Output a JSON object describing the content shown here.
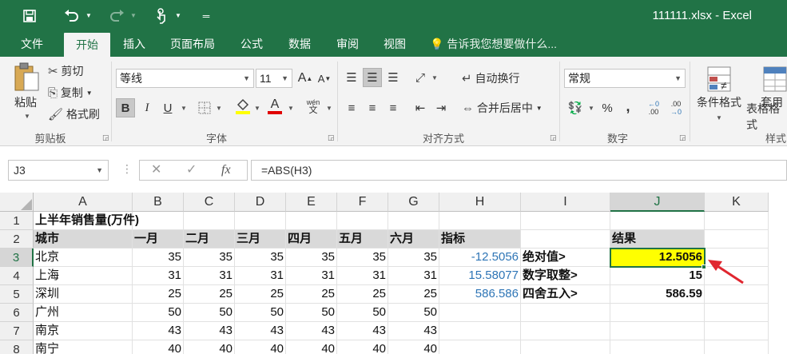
{
  "app": {
    "doc_title": "111111.xlsx - Excel",
    "accent": "#217346"
  },
  "quick_access": {
    "save_icon": "save-icon",
    "undo_icon": "undo-icon",
    "redo_icon": "redo-icon",
    "touch_icon": "touch-mode-icon",
    "customize_icon": "customize-icon"
  },
  "tabs": [
    {
      "label": "文件"
    },
    {
      "label": "开始"
    },
    {
      "label": "插入"
    },
    {
      "label": "页面布局"
    },
    {
      "label": "公式"
    },
    {
      "label": "数据"
    },
    {
      "label": "审阅"
    },
    {
      "label": "视图"
    }
  ],
  "tellme": "告诉我您想要做什么...",
  "ribbon": {
    "clipboard": {
      "paste": "粘贴",
      "cut": "剪切",
      "copy": "复制",
      "format_painter": "格式刷",
      "label": "剪贴板"
    },
    "font": {
      "font_name": "等线",
      "font_size": "11",
      "bold": "B",
      "italic": "I",
      "underline": "U",
      "font_color_glyph": "A",
      "grow": "A",
      "shrink": "A",
      "phonetic": "wén",
      "label": "字体"
    },
    "alignment": {
      "wrap": "自动换行",
      "merge": "合并后居中",
      "label": "对齐方式"
    },
    "number": {
      "format": "常规",
      "percent": "%",
      "comma": ",",
      "inc_decimal": ".00",
      "dec_decimal": ".00",
      "label": "数字"
    },
    "styles": {
      "conditional": "条件格式",
      "table_line1": "套用",
      "table_line2": "表格格式",
      "label": "样式"
    }
  },
  "formula_bar": {
    "name_box": "J3",
    "cancel": "✕",
    "enter": "✓",
    "fx": "fx",
    "formula": "=ABS(H3)"
  },
  "grid": {
    "columns": [
      "A",
      "B",
      "C",
      "D",
      "E",
      "F",
      "G",
      "H",
      "I",
      "J",
      "K"
    ],
    "rows": [
      "1",
      "2",
      "3",
      "4",
      "5",
      "6",
      "7",
      "8"
    ],
    "r1": {
      "A": "上半年销售量(万件)"
    },
    "r2": {
      "A": "城市",
      "B": "一月",
      "C": "二月",
      "D": "三月",
      "E": "四月",
      "F": "五月",
      "G": "六月",
      "H": "指标",
      "J": "结果"
    },
    "r3": {
      "A": "北京",
      "B": "35",
      "C": "35",
      "D": "35",
      "E": "35",
      "F": "35",
      "G": "35",
      "H": "-12.5056",
      "I": "绝对值>",
      "J": "12.5056"
    },
    "r4": {
      "A": "上海",
      "B": "31",
      "C": "31",
      "D": "31",
      "E": "31",
      "F": "31",
      "G": "31",
      "H": "15.58077",
      "I": "数字取整>",
      "J": "15"
    },
    "r5": {
      "A": "深圳",
      "B": "25",
      "C": "25",
      "D": "25",
      "E": "25",
      "F": "25",
      "G": "25",
      "H": "586.586",
      "I": "四舍五入>",
      "J": "586.59"
    },
    "r6": {
      "A": "广州",
      "B": "50",
      "C": "50",
      "D": "50",
      "E": "50",
      "F": "50",
      "G": "50"
    },
    "r7": {
      "A": "南京",
      "B": "43",
      "C": "43",
      "D": "43",
      "E": "43",
      "F": "43",
      "G": "43"
    },
    "r8": {
      "A": "南宁",
      "B": "40",
      "C": "40",
      "D": "40",
      "E": "40",
      "F": "40",
      "G": "40"
    },
    "selected_cell": "J3",
    "highlight_color": "#ffff00",
    "arrow_color": "#e0262f"
  }
}
